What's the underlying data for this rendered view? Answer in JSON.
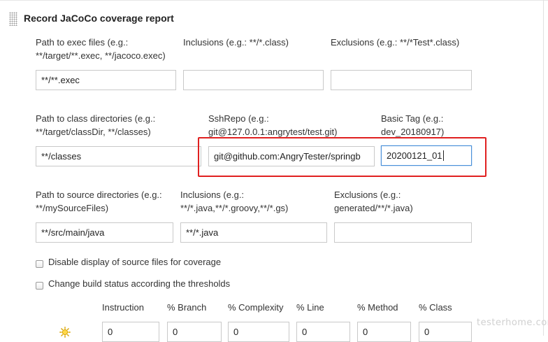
{
  "section": {
    "title": "Record JaCoCo coverage report"
  },
  "row1": {
    "exec_label": "Path to exec files (e.g.:\n**/target/**.exec, **/jacoco.exec)",
    "exec_value": "**/**.exec",
    "inclusions_label": "Inclusions (e.g.: **/*.class)",
    "inclusions_value": "",
    "exclusions_label": "Exclusions (e.g.: **/*Test*.class)",
    "exclusions_value": ""
  },
  "row2": {
    "class_label": "Path to class directories (e.g.:\n**/target/classDir, **/classes)",
    "class_value": "**/classes",
    "ssh_label": "SshRepo (e.g.:\ngit@127.0.0.1:angrytest/test.git)",
    "ssh_value": "git@github.com:AngryTester/springb",
    "tag_label": "Basic Tag (e.g.:\ndev_20180917)",
    "tag_value": "20200121_01"
  },
  "row3": {
    "source_label": "Path to source directories (e.g.:\n**/mySourceFiles)",
    "source_value": "**/src/main/java",
    "inclusions_label": "Inclusions (e.g.:\n**/*.java,**/*.groovy,**/*.gs)",
    "inclusions_value": "**/*.java",
    "exclusions_label": "Exclusions (e.g.:\ngenerated/**/*.java)",
    "exclusions_value": ""
  },
  "options": {
    "disable_source_label": "Disable display of source files for coverage",
    "disable_source_checked": false,
    "change_build_label": "Change build status according the thresholds",
    "change_build_checked": false
  },
  "thresholds": {
    "headers": [
      "Instruction",
      "% Branch",
      "% Complexity",
      "% Line",
      "% Method",
      "% Class"
    ],
    "values": [
      "0",
      "0",
      "0",
      "0",
      "0",
      "0"
    ],
    "row_icon": "sun-icon"
  },
  "watermark": "testerhome.com",
  "colors": {
    "highlight": "#e02020",
    "focus": "#4a90d9"
  }
}
